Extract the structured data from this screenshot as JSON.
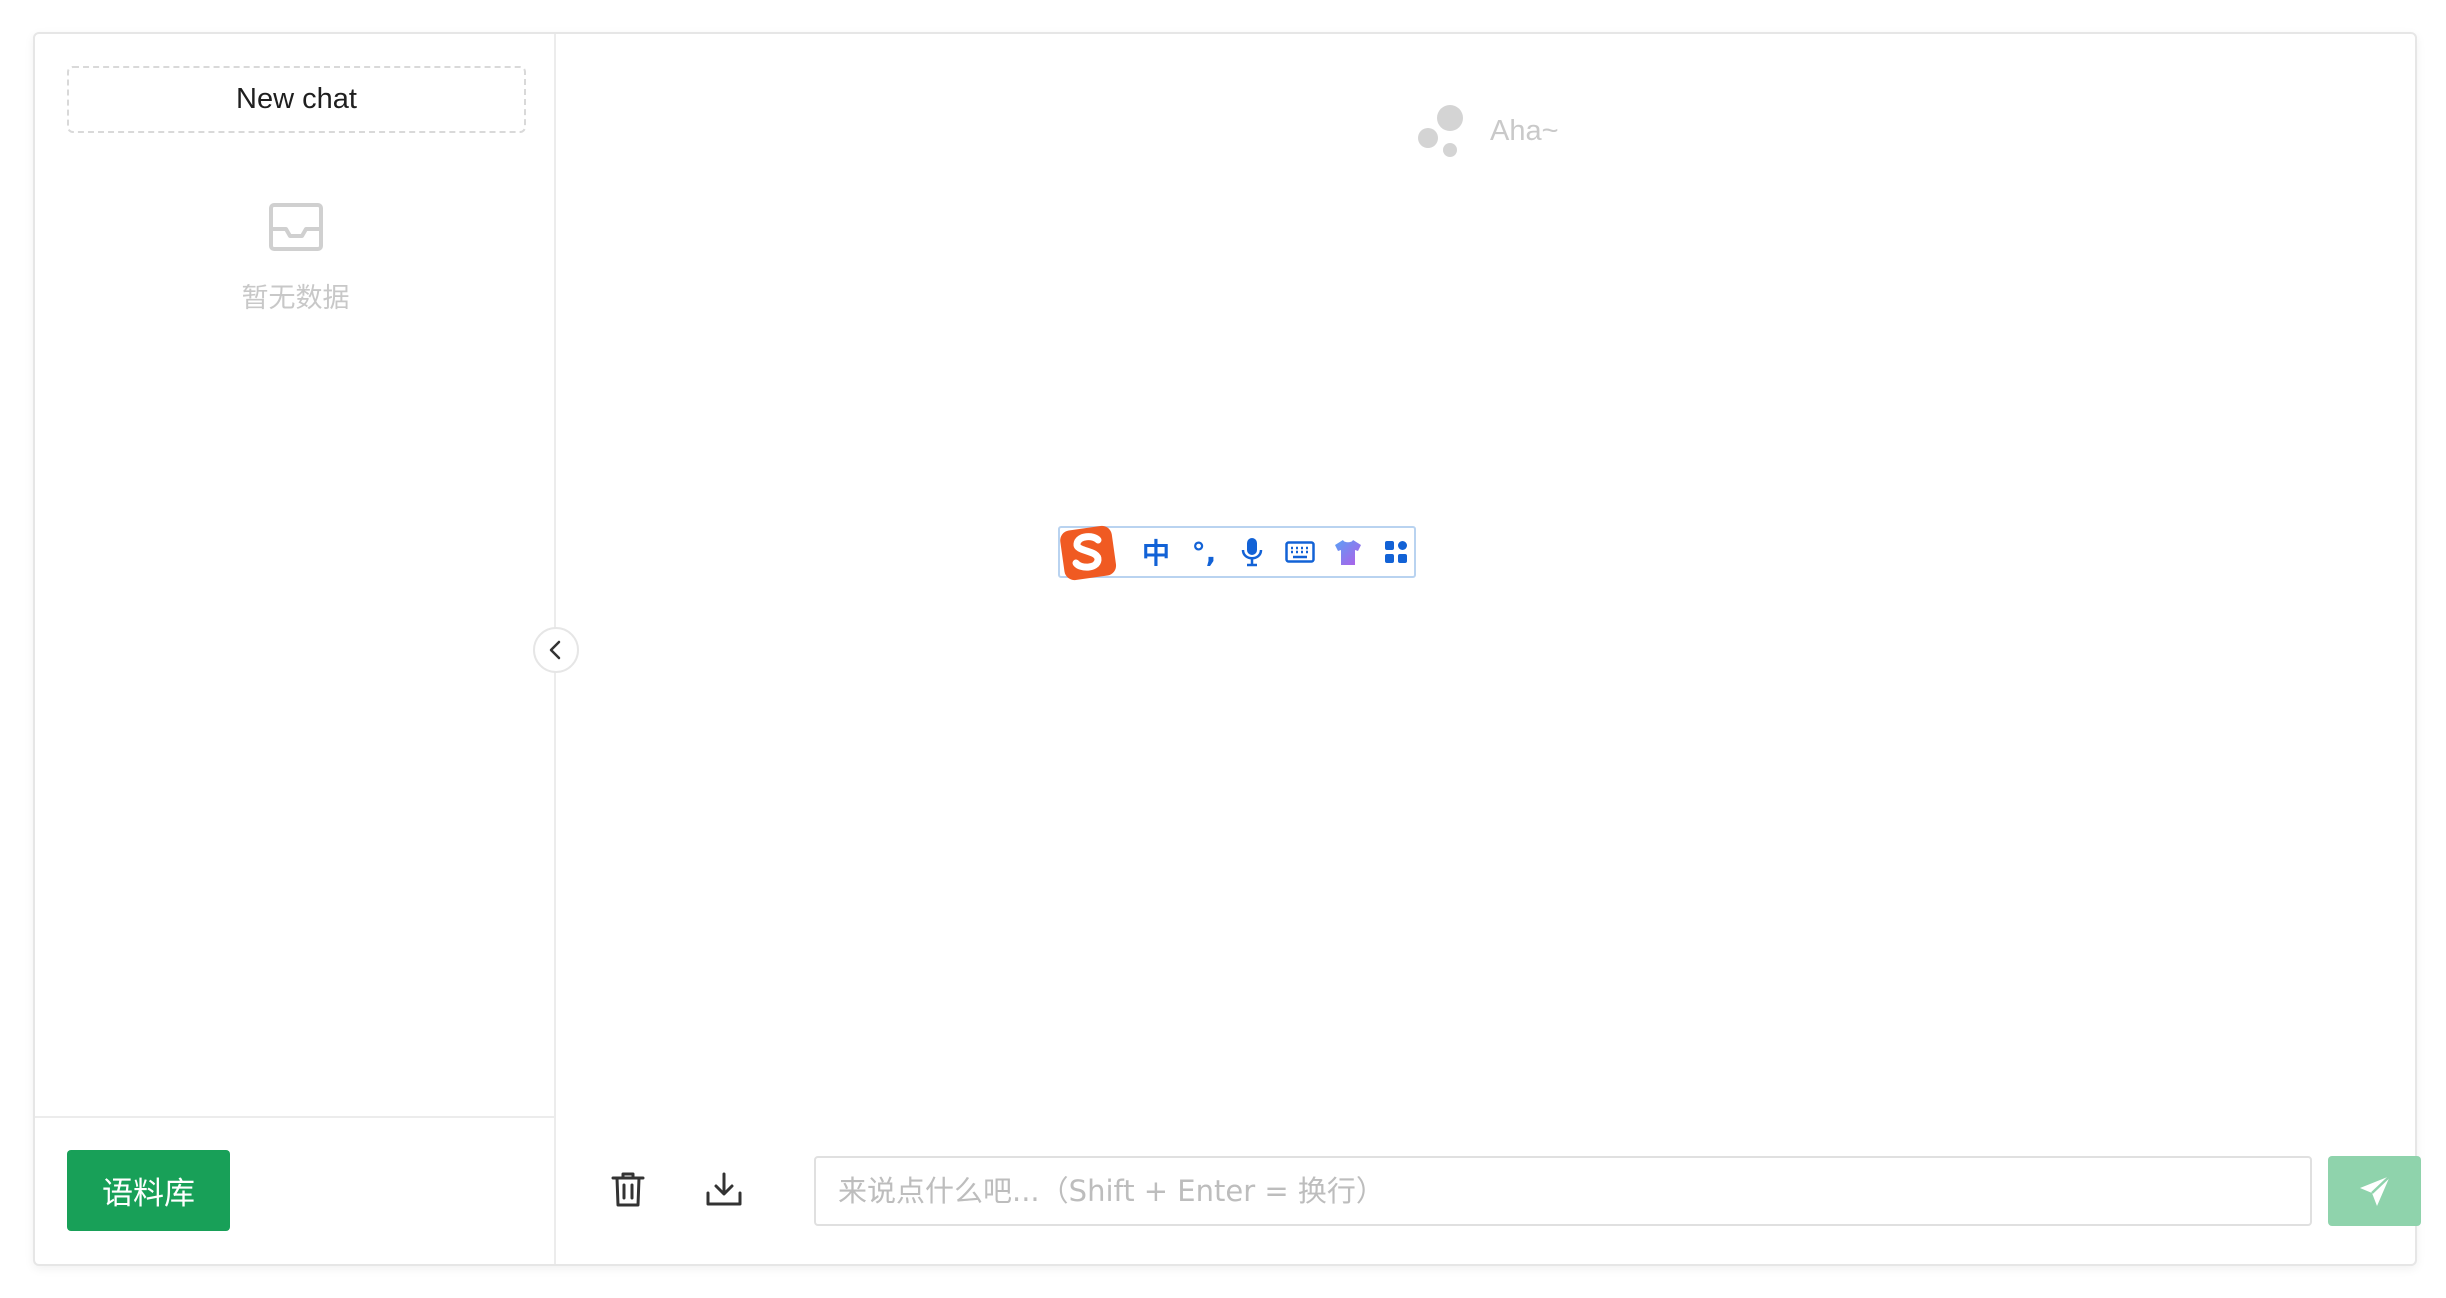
{
  "sidebar": {
    "new_chat_label": "New chat",
    "empty_text": "暂无数据",
    "empty_icon": "inbox-icon",
    "corpus_button_label": "语料库"
  },
  "main": {
    "brand_text": "Aha~",
    "brand_icon": "bubbles-logo-icon"
  },
  "ime_toolbar": {
    "logo_icon": "sogou-logo-icon",
    "items": [
      {
        "label": "中",
        "icon": "chinese-mode-icon"
      },
      {
        "label": "°,",
        "icon": "punctuation-icon"
      },
      {
        "label": "",
        "icon": "microphone-icon"
      },
      {
        "label": "",
        "icon": "keyboard-icon"
      },
      {
        "label": "",
        "icon": "skin-shirt-icon"
      },
      {
        "label": "",
        "icon": "toolbox-grid-icon"
      }
    ]
  },
  "input": {
    "placeholder": "来说点什么吧...（Shift + Enter = 换行）",
    "value": "",
    "delete_icon": "trash-icon",
    "download_icon": "download-icon",
    "send_icon": "send-icon"
  },
  "colors": {
    "primary": "#18a058",
    "primary_disabled": "#8fd3ac",
    "ime_blue": "#1262d6",
    "ime_orange": "#f05a22"
  }
}
